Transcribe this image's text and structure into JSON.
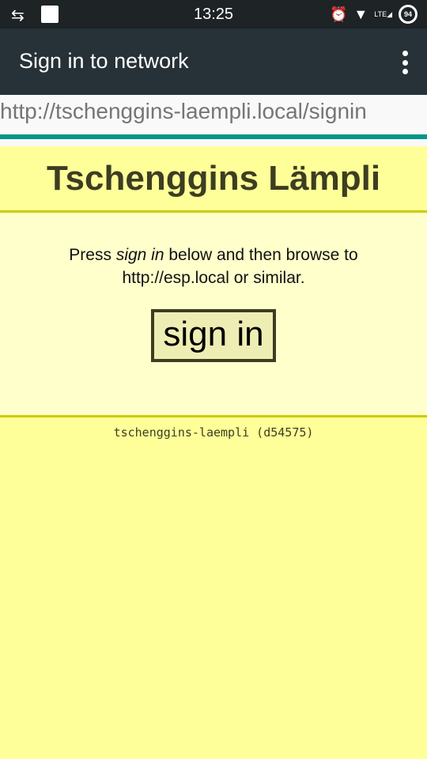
{
  "status_bar": {
    "time": "13:25",
    "battery": "94",
    "network": "LTE"
  },
  "toolbar": {
    "title": "Sign in to network"
  },
  "url_bar": {
    "url": "http://tschenggins-laempli.local/signin"
  },
  "page": {
    "heading": "Tschenggins Lämpli",
    "instruction_pre": "Press ",
    "instruction_em": "sign in",
    "instruction_post": " below and then browse to http://esp.local or similar.",
    "sign_in_label": "sign in",
    "footer": "tschenggins-laempli (d54575)"
  }
}
